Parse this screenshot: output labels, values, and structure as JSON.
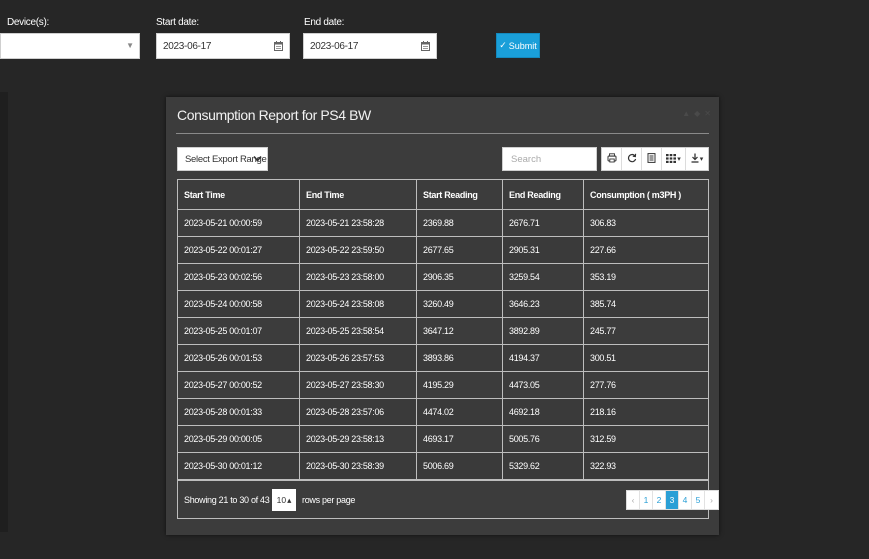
{
  "filters": {
    "device_label": "Device(s):",
    "device_value": "",
    "start_label": "Start date:",
    "start_value": "2023-06-17",
    "end_label": "End date:",
    "end_value": "2023-06-17",
    "submit_label": "Submit"
  },
  "report": {
    "title": "Consumption Report for PS4 BW",
    "export_select_value": "Select Export Range",
    "search_placeholder": "Search",
    "columns": [
      "Start Time",
      "End Time",
      "Start Reading",
      "End Reading",
      "Consumption ( m3PH )"
    ],
    "rows": [
      [
        "2023-05-21 00:00:59",
        "2023-05-21 23:58:28",
        "2369.88",
        "2676.71",
        "306.83"
      ],
      [
        "2023-05-22 00:01:27",
        "2023-05-22 23:59:50",
        "2677.65",
        "2905.31",
        "227.66"
      ],
      [
        "2023-05-23 00:02:56",
        "2023-05-23 23:58:00",
        "2906.35",
        "3259.54",
        "353.19"
      ],
      [
        "2023-05-24 00:00:58",
        "2023-05-24 23:58:08",
        "3260.49",
        "3646.23",
        "385.74"
      ],
      [
        "2023-05-25 00:01:07",
        "2023-05-25 23:58:54",
        "3647.12",
        "3892.89",
        "245.77"
      ],
      [
        "2023-05-26 00:01:53",
        "2023-05-26 23:57:53",
        "3893.86",
        "4194.37",
        "300.51"
      ],
      [
        "2023-05-27 00:00:52",
        "2023-05-27 23:58:30",
        "4195.29",
        "4473.05",
        "277.76"
      ],
      [
        "2023-05-28 00:01:33",
        "2023-05-28 23:57:06",
        "4474.02",
        "4692.18",
        "218.16"
      ],
      [
        "2023-05-29 00:00:05",
        "2023-05-29 23:58:13",
        "4693.17",
        "5005.76",
        "312.59"
      ],
      [
        "2023-05-30 00:01:12",
        "2023-05-30 23:58:39",
        "5006.69",
        "5329.62",
        "322.93"
      ]
    ],
    "pagination": {
      "info": "Showing 21 to 30 of 43 rows",
      "page_size": "10",
      "per_page_label": "rows per page",
      "prev": "‹",
      "pages": [
        "1",
        "2",
        "3",
        "4",
        "5"
      ],
      "active_page": "3",
      "next": "›"
    }
  },
  "colors": {
    "background": "#262626",
    "panel": "#3c3c3c",
    "accent": "#2a9fd6",
    "submit": "#1a9fd9"
  },
  "icons": [
    "chevron-down-icon",
    "calendar-icon",
    "check-icon",
    "print-icon",
    "refresh-icon",
    "export-file-icon",
    "columns-grid-icon",
    "download-icon",
    "caret-down-icon"
  ]
}
